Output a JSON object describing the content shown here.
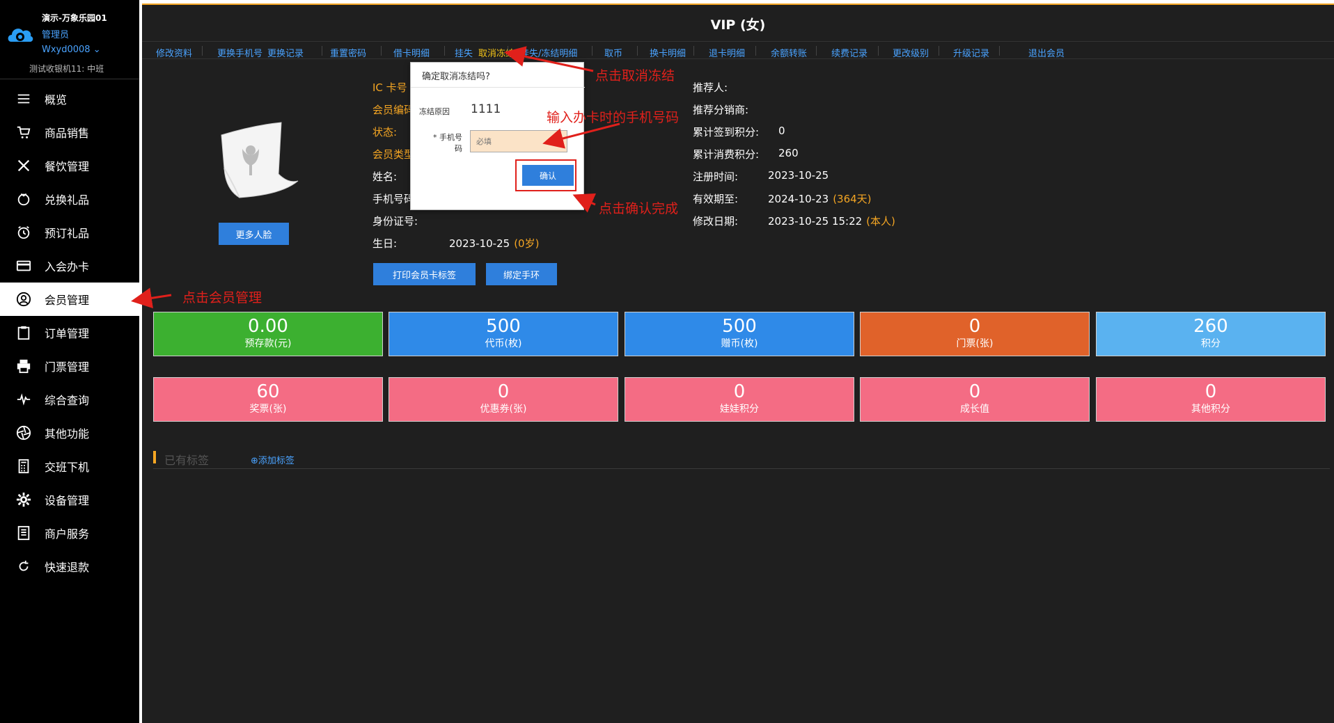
{
  "sidebar": {
    "org_name": "演示-万象乐园01",
    "role": "管理员",
    "user": "Wxyd0008 ⌄",
    "shift": "测试收银机11: 中班",
    "items": [
      {
        "label": "概览",
        "icon": "menu-icon"
      },
      {
        "label": "商品销售",
        "icon": "cart-icon"
      },
      {
        "label": "餐饮管理",
        "icon": "utensils-icon"
      },
      {
        "label": "兑换礼品",
        "icon": "gift-icon"
      },
      {
        "label": "预订礼品",
        "icon": "alarm-clock-icon"
      },
      {
        "label": "入会办卡",
        "icon": "card-icon"
      },
      {
        "label": "会员管理",
        "icon": "user-icon"
      },
      {
        "label": "订单管理",
        "icon": "clipboard-icon"
      },
      {
        "label": "门票管理",
        "icon": "printer-icon"
      },
      {
        "label": "综合查询",
        "icon": "pulse-icon"
      },
      {
        "label": "其他功能",
        "icon": "aperture-icon"
      },
      {
        "label": "交班下机",
        "icon": "calculator-icon"
      },
      {
        "label": "设备管理",
        "icon": "gear-icon"
      },
      {
        "label": "商户服务",
        "icon": "document-icon"
      },
      {
        "label": "快速退款",
        "icon": "refresh-icon"
      }
    ],
    "active_index": 6
  },
  "main": {
    "title": "VIP (女)",
    "tabs": [
      "修改资料",
      "更换手机号",
      "更换记录",
      "重置密码",
      "借卡明细",
      "挂失",
      "取消冻结",
      "挂失/冻结明细",
      "取币",
      "换卡明细",
      "退卡明细",
      "余额转账",
      "续费记录",
      "更改级别",
      "升级记录",
      "退出会员"
    ],
    "highlight_tab": "取消冻结",
    "more_faces_button": "更多人脸",
    "left_info": [
      {
        "label": "IC 卡号",
        "value": ""
      },
      {
        "label": "会员编码",
        "value": ""
      },
      {
        "label": "状态:",
        "value": ""
      },
      {
        "label": "会员类型",
        "value": ""
      },
      {
        "label": "姓名:",
        "value": ""
      },
      {
        "label": "手机号码",
        "value": ""
      },
      {
        "label": "身份证号:",
        "value": ""
      },
      {
        "label": "生日:",
        "value": "2023-10-25",
        "extra": "(0岁)"
      }
    ],
    "right_info": [
      {
        "label": "推荐人:",
        "value": ""
      },
      {
        "label": "推荐分销商:",
        "value": ""
      },
      {
        "label": "累计签到积分:",
        "value": "0"
      },
      {
        "label": "累计消费积分:",
        "value": "260"
      },
      {
        "label": "注册时间:",
        "value": "2023-10-25"
      },
      {
        "label": "有效期至:",
        "value": "2024-10-23",
        "extra": "(364天)"
      },
      {
        "label": "修改日期:",
        "value": "2023-10-25 15:22",
        "extra": "(本人)"
      }
    ],
    "print_tag_button": "打印会员卡标签",
    "bind_wristband_button": "绑定手环",
    "stats_row1": [
      {
        "value": "0.00",
        "label": "预存款(元)",
        "color": "#3cb030"
      },
      {
        "value": "500",
        "label": "代币(枚)",
        "color": "#2f8ae8"
      },
      {
        "value": "500",
        "label": "赠币(枚)",
        "color": "#2f8ae8"
      },
      {
        "value": "0",
        "label": "门票(张)",
        "color": "#e0622a"
      },
      {
        "value": "260",
        "label": "积分",
        "color": "#5ab2f0"
      }
    ],
    "stats_row2": [
      {
        "value": "60",
        "label": "奖票(张)",
        "color": "#f46c84"
      },
      {
        "value": "0",
        "label": "优惠券(张)",
        "color": "#f46c84"
      },
      {
        "value": "0",
        "label": "娃娃积分",
        "color": "#f46c84"
      },
      {
        "value": "0",
        "label": "成长值",
        "color": "#f46c84"
      },
      {
        "value": "0",
        "label": "其他积分",
        "color": "#f46c84"
      }
    ],
    "tags_title": "已有标签",
    "add_tag": "⊕添加标签"
  },
  "dialog": {
    "title": "确定取消冻结吗?",
    "reason_label": "冻结原因",
    "reason_value": "1111",
    "phone_label_line1": "* 手机号",
    "phone_label_line2": "码",
    "phone_placeholder": "必填",
    "confirm": "确认"
  },
  "annotations": {
    "cancel_freeze": "点击取消冻结",
    "input_phone": "输入办卡时的手机号码",
    "confirm_done": "点击确认完成",
    "member_mgmt": "点击会员管理"
  }
}
